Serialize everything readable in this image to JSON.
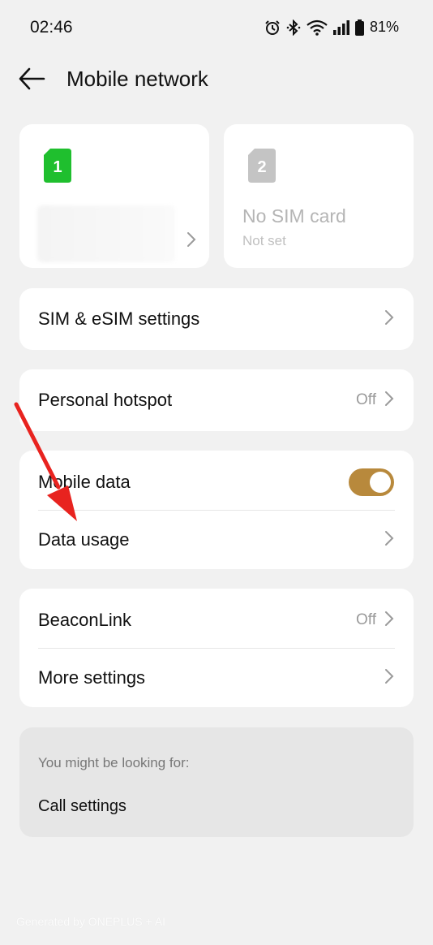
{
  "status_bar": {
    "time": "02:46",
    "battery_percent": "81%",
    "icons": [
      "alarm-icon",
      "bluetooth-icon",
      "wifi-icon",
      "signal-icon",
      "battery-icon"
    ]
  },
  "header": {
    "title": "Mobile network",
    "back_icon": "back-arrow-icon"
  },
  "sim_cards": [
    {
      "slot": "1",
      "badge_color": "#1fbf2e",
      "name": "",
      "status": ""
    },
    {
      "slot": "2",
      "badge_color": "#c4c4c4",
      "name": "No SIM card",
      "status": "Not set"
    }
  ],
  "sim_settings": {
    "label": "SIM & eSIM settings"
  },
  "hotspot": {
    "label": "Personal hotspot",
    "value": "Off"
  },
  "mobile_data": {
    "label": "Mobile data",
    "enabled": true,
    "toggle_color": "#b8893c"
  },
  "data_usage": {
    "label": "Data usage"
  },
  "beaconlink": {
    "label": "BeaconLink",
    "value": "Off"
  },
  "more_settings": {
    "label": "More settings"
  },
  "suggestions": {
    "title": "You might be looking for:",
    "items": [
      "Call settings"
    ]
  },
  "watermark": "Generated by ONEPLUS + AI",
  "annotation_color": "#e8231f"
}
